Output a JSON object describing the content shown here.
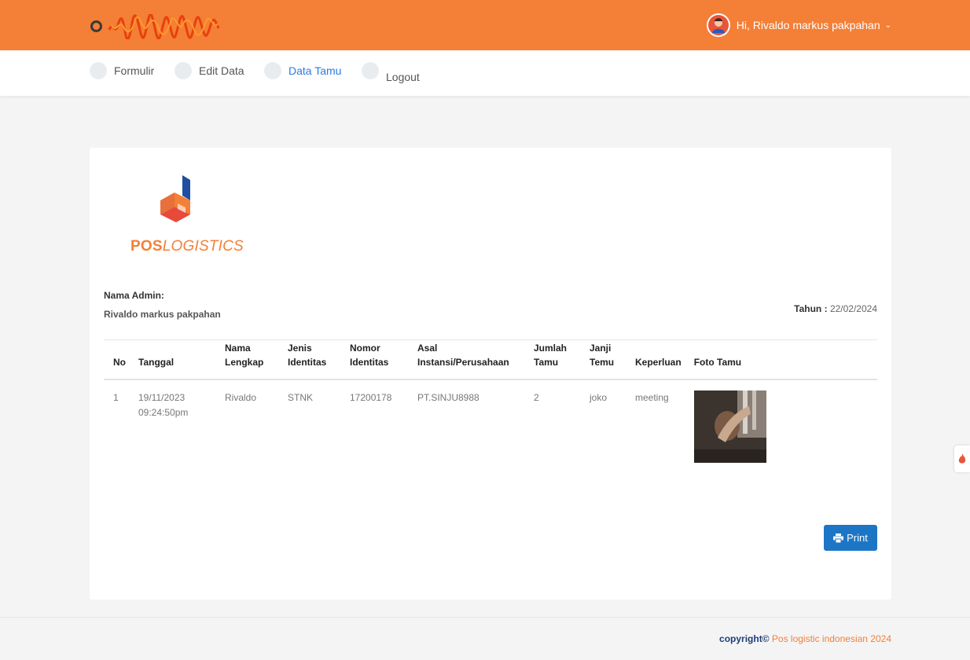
{
  "header": {
    "user_greeting": "Hi, Rivaldo markus pakpahan"
  },
  "nav": {
    "items": [
      {
        "label": "Formulir"
      },
      {
        "label": "Edit Data"
      },
      {
        "label": "Data Tamu"
      },
      {
        "label": "Logout"
      }
    ],
    "active": "Data Tamu"
  },
  "logo": {
    "pos": "POS",
    "logistics": "LOGISTICS"
  },
  "admin": {
    "label": "Nama Admin:",
    "name": "Rivaldo markus pakpahan"
  },
  "tahun": {
    "label": "Tahun :",
    "value": "22/02/2024"
  },
  "table": {
    "headers": {
      "no": "No",
      "tanggal": "Tanggal",
      "nama_1": "Nama",
      "nama_2": "Lengkap",
      "jenis_1": "Jenis",
      "jenis_2": "Identitas",
      "nomor_1": "Nomor",
      "nomor_2": "Identitas",
      "asal_1": "Asal",
      "asal_2": "Instansi/Perusahaan",
      "jumlah_1": "Jumlah",
      "jumlah_2": "Tamu",
      "janji_1": "Janji",
      "janji_2": "Temu",
      "keperluan": "Keperluan",
      "foto": "Foto Tamu"
    },
    "rows": [
      {
        "no": "1",
        "tanggal_date": "19/11/2023",
        "tanggal_time": "09:24:50pm",
        "nama": "Rivaldo",
        "jenis": "STNK",
        "nomor": "17200178",
        "asal": "PT.SINJU8988",
        "jumlah": "2",
        "janji": "joko",
        "keperluan": "meeting"
      }
    ]
  },
  "print_label": "Print",
  "footer": {
    "copyright_bold": "copyright©",
    "company": " Pos logistic indonesian 2024"
  },
  "colors": {
    "primary_orange": "#f47f36",
    "button_blue": "#1d76c5",
    "active_link": "#2a7ae2",
    "copyright_navy": "#1e3d7a"
  }
}
